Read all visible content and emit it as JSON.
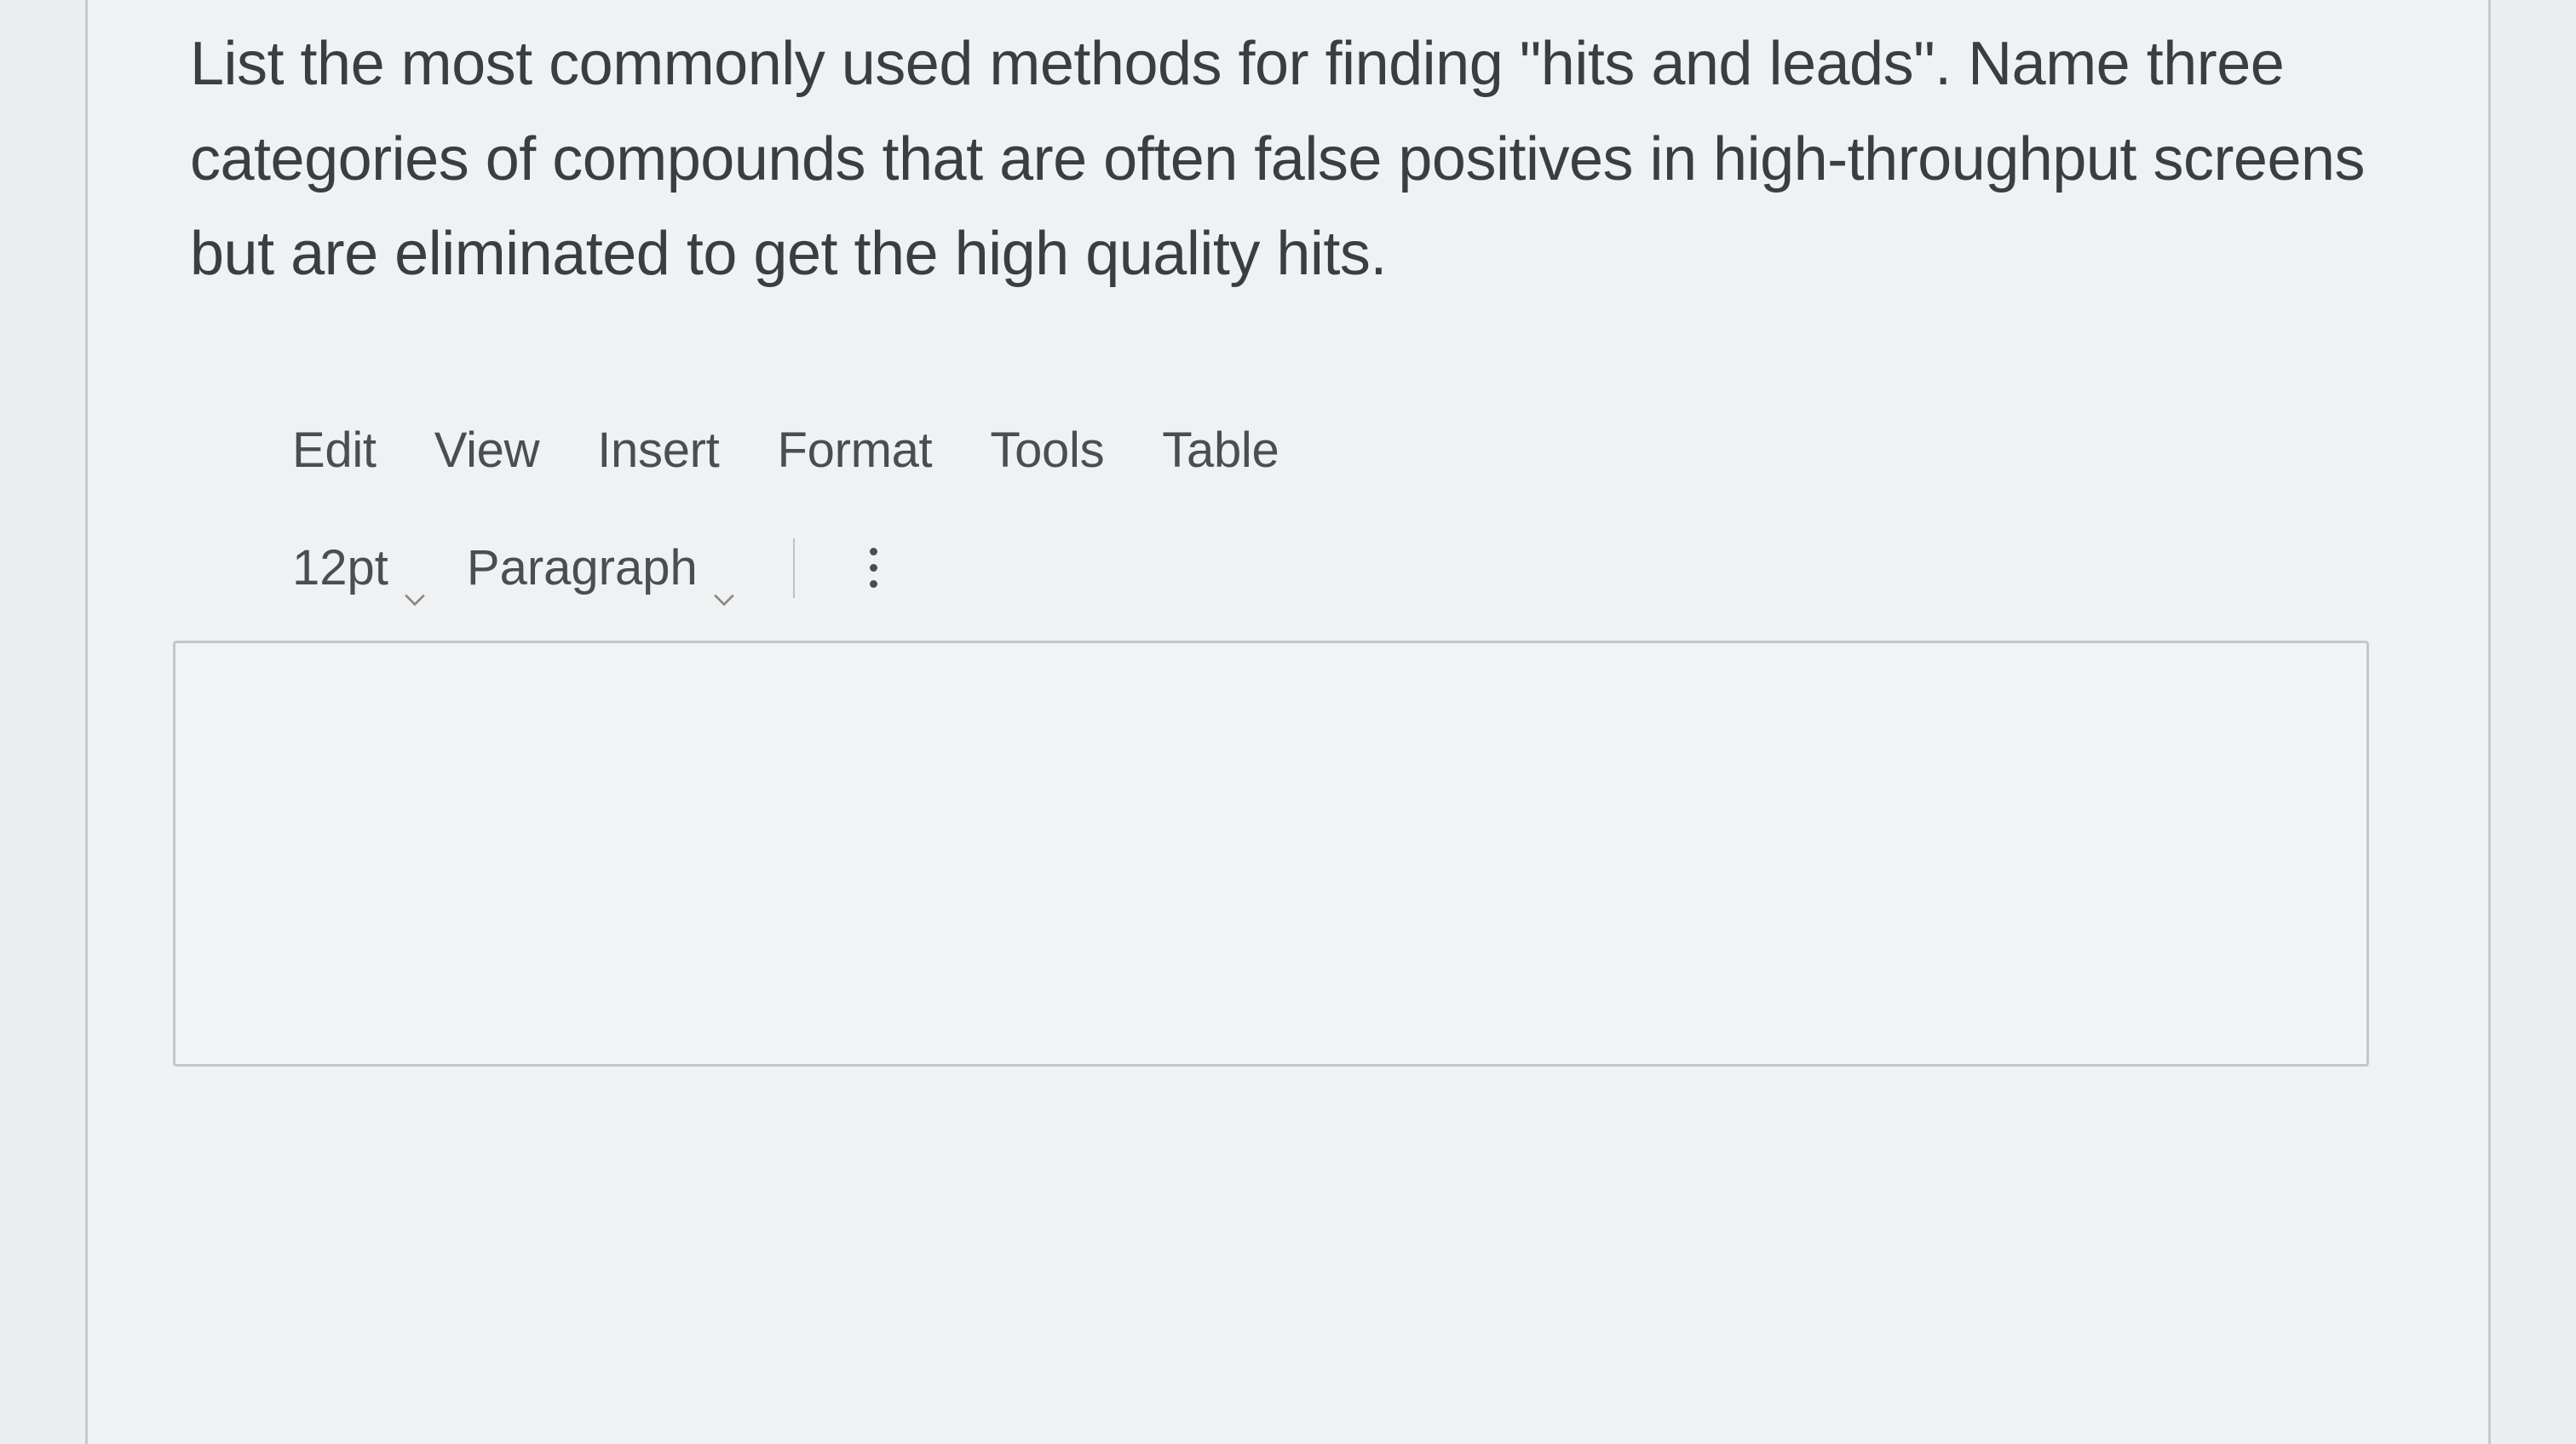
{
  "question": {
    "text": "List the most commonly used methods for finding \"hits and leads\". Name three categories of compounds that are often false positives in high-throughput screens but are eliminated to get the high quality hits."
  },
  "editor": {
    "menu": {
      "edit": "Edit",
      "view": "View",
      "insert": "Insert",
      "format": "Format",
      "tools": "Tools",
      "table": "Table"
    },
    "toolbar": {
      "fontSize": "12pt",
      "blockFormat": "Paragraph"
    }
  }
}
